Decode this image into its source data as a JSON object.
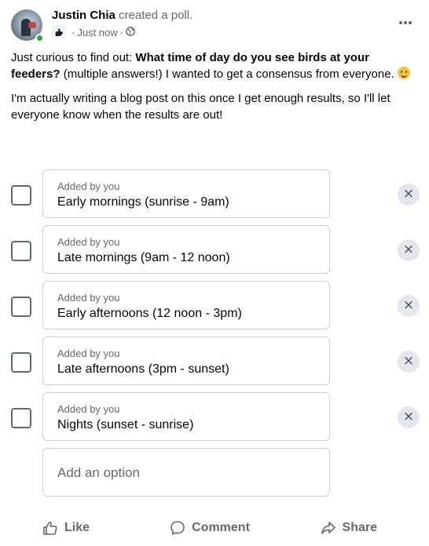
{
  "post": {
    "author": "Justin Chia",
    "action": " created a poll.",
    "timestamp": "Just now",
    "meta_separator": "·",
    "more_icon": "more-horizontal-icon",
    "audience_icon": "globe-icon",
    "group_icon": "group-icon"
  },
  "text": {
    "p1_lead": "Just curious to find out: ",
    "p1_bold": "What time of day do you see birds at your feeders?",
    "p1_tail": " (multiple answers!) I wanted to get a consensus from everyone. ",
    "p2": "I'm actually writing a blog post on this once I get enough results, so I'll let everyone know when the results are out!"
  },
  "poll": {
    "options": [
      {
        "added_by": "Added by you",
        "label": "Early mornings (sunrise - 9am)",
        "checked": false
      },
      {
        "added_by": "Added by you",
        "label": "Late mornings (9am - 12 noon)",
        "checked": false
      },
      {
        "added_by": "Added by you",
        "label": "Early afternoons (12 noon - 3pm)",
        "checked": false
      },
      {
        "added_by": "Added by you",
        "label": "Late afternoons (3pm - sunset)",
        "checked": false
      },
      {
        "added_by": "Added by you",
        "label": "Nights (sunset - sunrise)",
        "checked": false
      }
    ],
    "remove_symbol": "×",
    "add_option_placeholder": "Add an option"
  },
  "actions": {
    "like": "Like",
    "comment": "Comment",
    "share": "Share"
  },
  "colors": {
    "online": "#31a24c",
    "secondary_text": "#65676b",
    "border": "#ccd0d5"
  }
}
